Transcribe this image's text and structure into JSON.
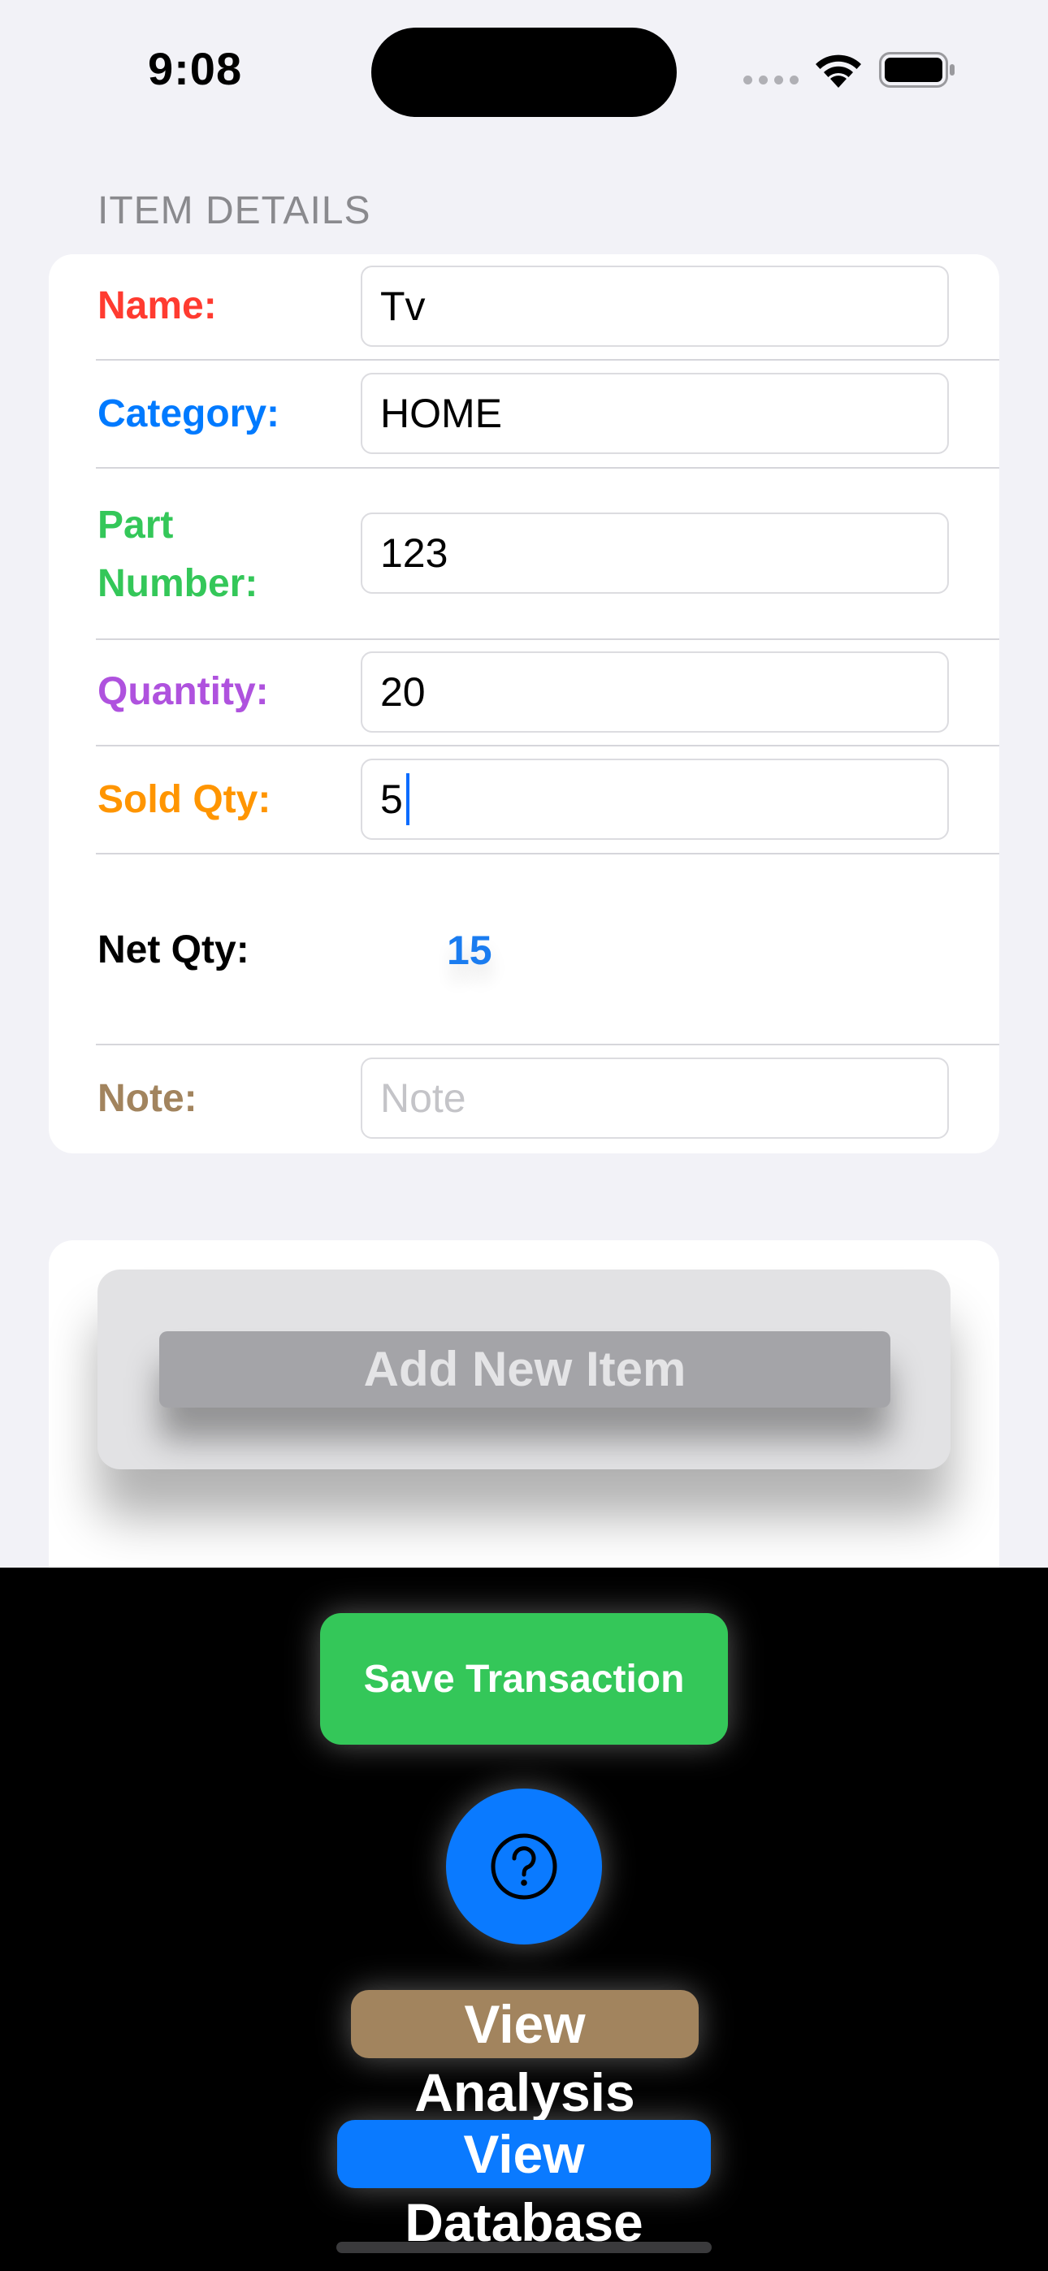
{
  "status_bar": {
    "time": "9:08"
  },
  "section": {
    "title": "ITEM DETAILS"
  },
  "form": {
    "name": {
      "label": "Name:",
      "value": "Tv",
      "color": "#ff3b30"
    },
    "category": {
      "label": "Category:",
      "value": "HOME",
      "color": "#007aff"
    },
    "part_number": {
      "label_line1": "Part",
      "label_line2": "Number:",
      "value": "123",
      "color": "#34c759"
    },
    "quantity": {
      "label": "Quantity:",
      "value": "20",
      "color": "#af52de"
    },
    "sold_qty": {
      "label": "Sold Qty:",
      "value": "5",
      "color": "#ff9500"
    },
    "net_qty": {
      "label": "Net Qty:",
      "value": "15",
      "value_color": "#1a7cf0"
    },
    "note": {
      "label": "Note:",
      "value": "",
      "placeholder": "Note",
      "color": "#a2845e"
    }
  },
  "actions": {
    "add_item_label": "Add New Item",
    "save_label": "Save Transaction",
    "analysis_label": "View Analysis",
    "database_label": "View Database"
  },
  "icons": {
    "help": "question-circle-icon",
    "wifi": "wifi-icon",
    "battery": "battery-icon",
    "signal": "cellular-signal-icon"
  },
  "colors": {
    "save_button": "#34c759",
    "help_button": "#0a7aff",
    "analysis_button": "#a2845e",
    "database_button": "#0a7aff"
  }
}
